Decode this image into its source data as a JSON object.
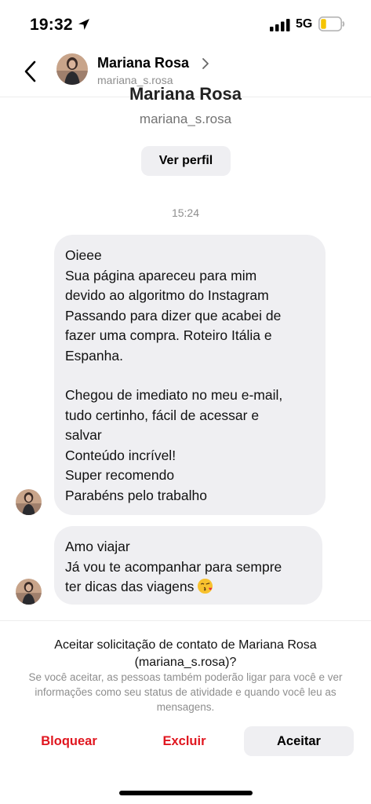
{
  "status_bar": {
    "time": "19:32",
    "network": "5G",
    "battery_color": "#f5c400"
  },
  "header": {
    "name": "Mariana Rosa",
    "username": "mariana_s.rosa"
  },
  "profile": {
    "name": "Mariana Rosa",
    "username": "mariana_s.rosa",
    "view_profile_label": "Ver perfil"
  },
  "thread": {
    "timestamp": "15:24",
    "messages": [
      {
        "lines": [
          "Oieee",
          "Sua página apareceu para mim",
          "devido ao algoritmo do Instagram",
          "Passando para dizer que acabei de",
          "fazer uma compra. Roteiro Itália e",
          "Espanha.",
          "",
          "Chegou de imediato no meu e-mail,",
          "tudo certinho, fácil de acessar e",
          "salvar",
          "Conteúdo incrível!",
          "Super recomendo",
          "Parabéns pelo trabalho"
        ]
      },
      {
        "lines": [
          "Amo viajar",
          "Já vou te acompanhar para sempre",
          "ter dicas das viagens"
        ],
        "emoji": "kissing-face-emoji"
      }
    ]
  },
  "request": {
    "title": "Aceitar solicitação de contato de Mariana Rosa (mariana_s.rosa)?",
    "description": "Se você aceitar, as pessoas também poderão ligar para você e ver informações como seu status de atividade e quando você leu as mensagens.",
    "block_label": "Bloquear",
    "delete_label": "Excluir",
    "accept_label": "Aceitar"
  },
  "colors": {
    "bubble": "#efeff2",
    "danger": "#e0161f",
    "muted": "#8e8e8e"
  }
}
